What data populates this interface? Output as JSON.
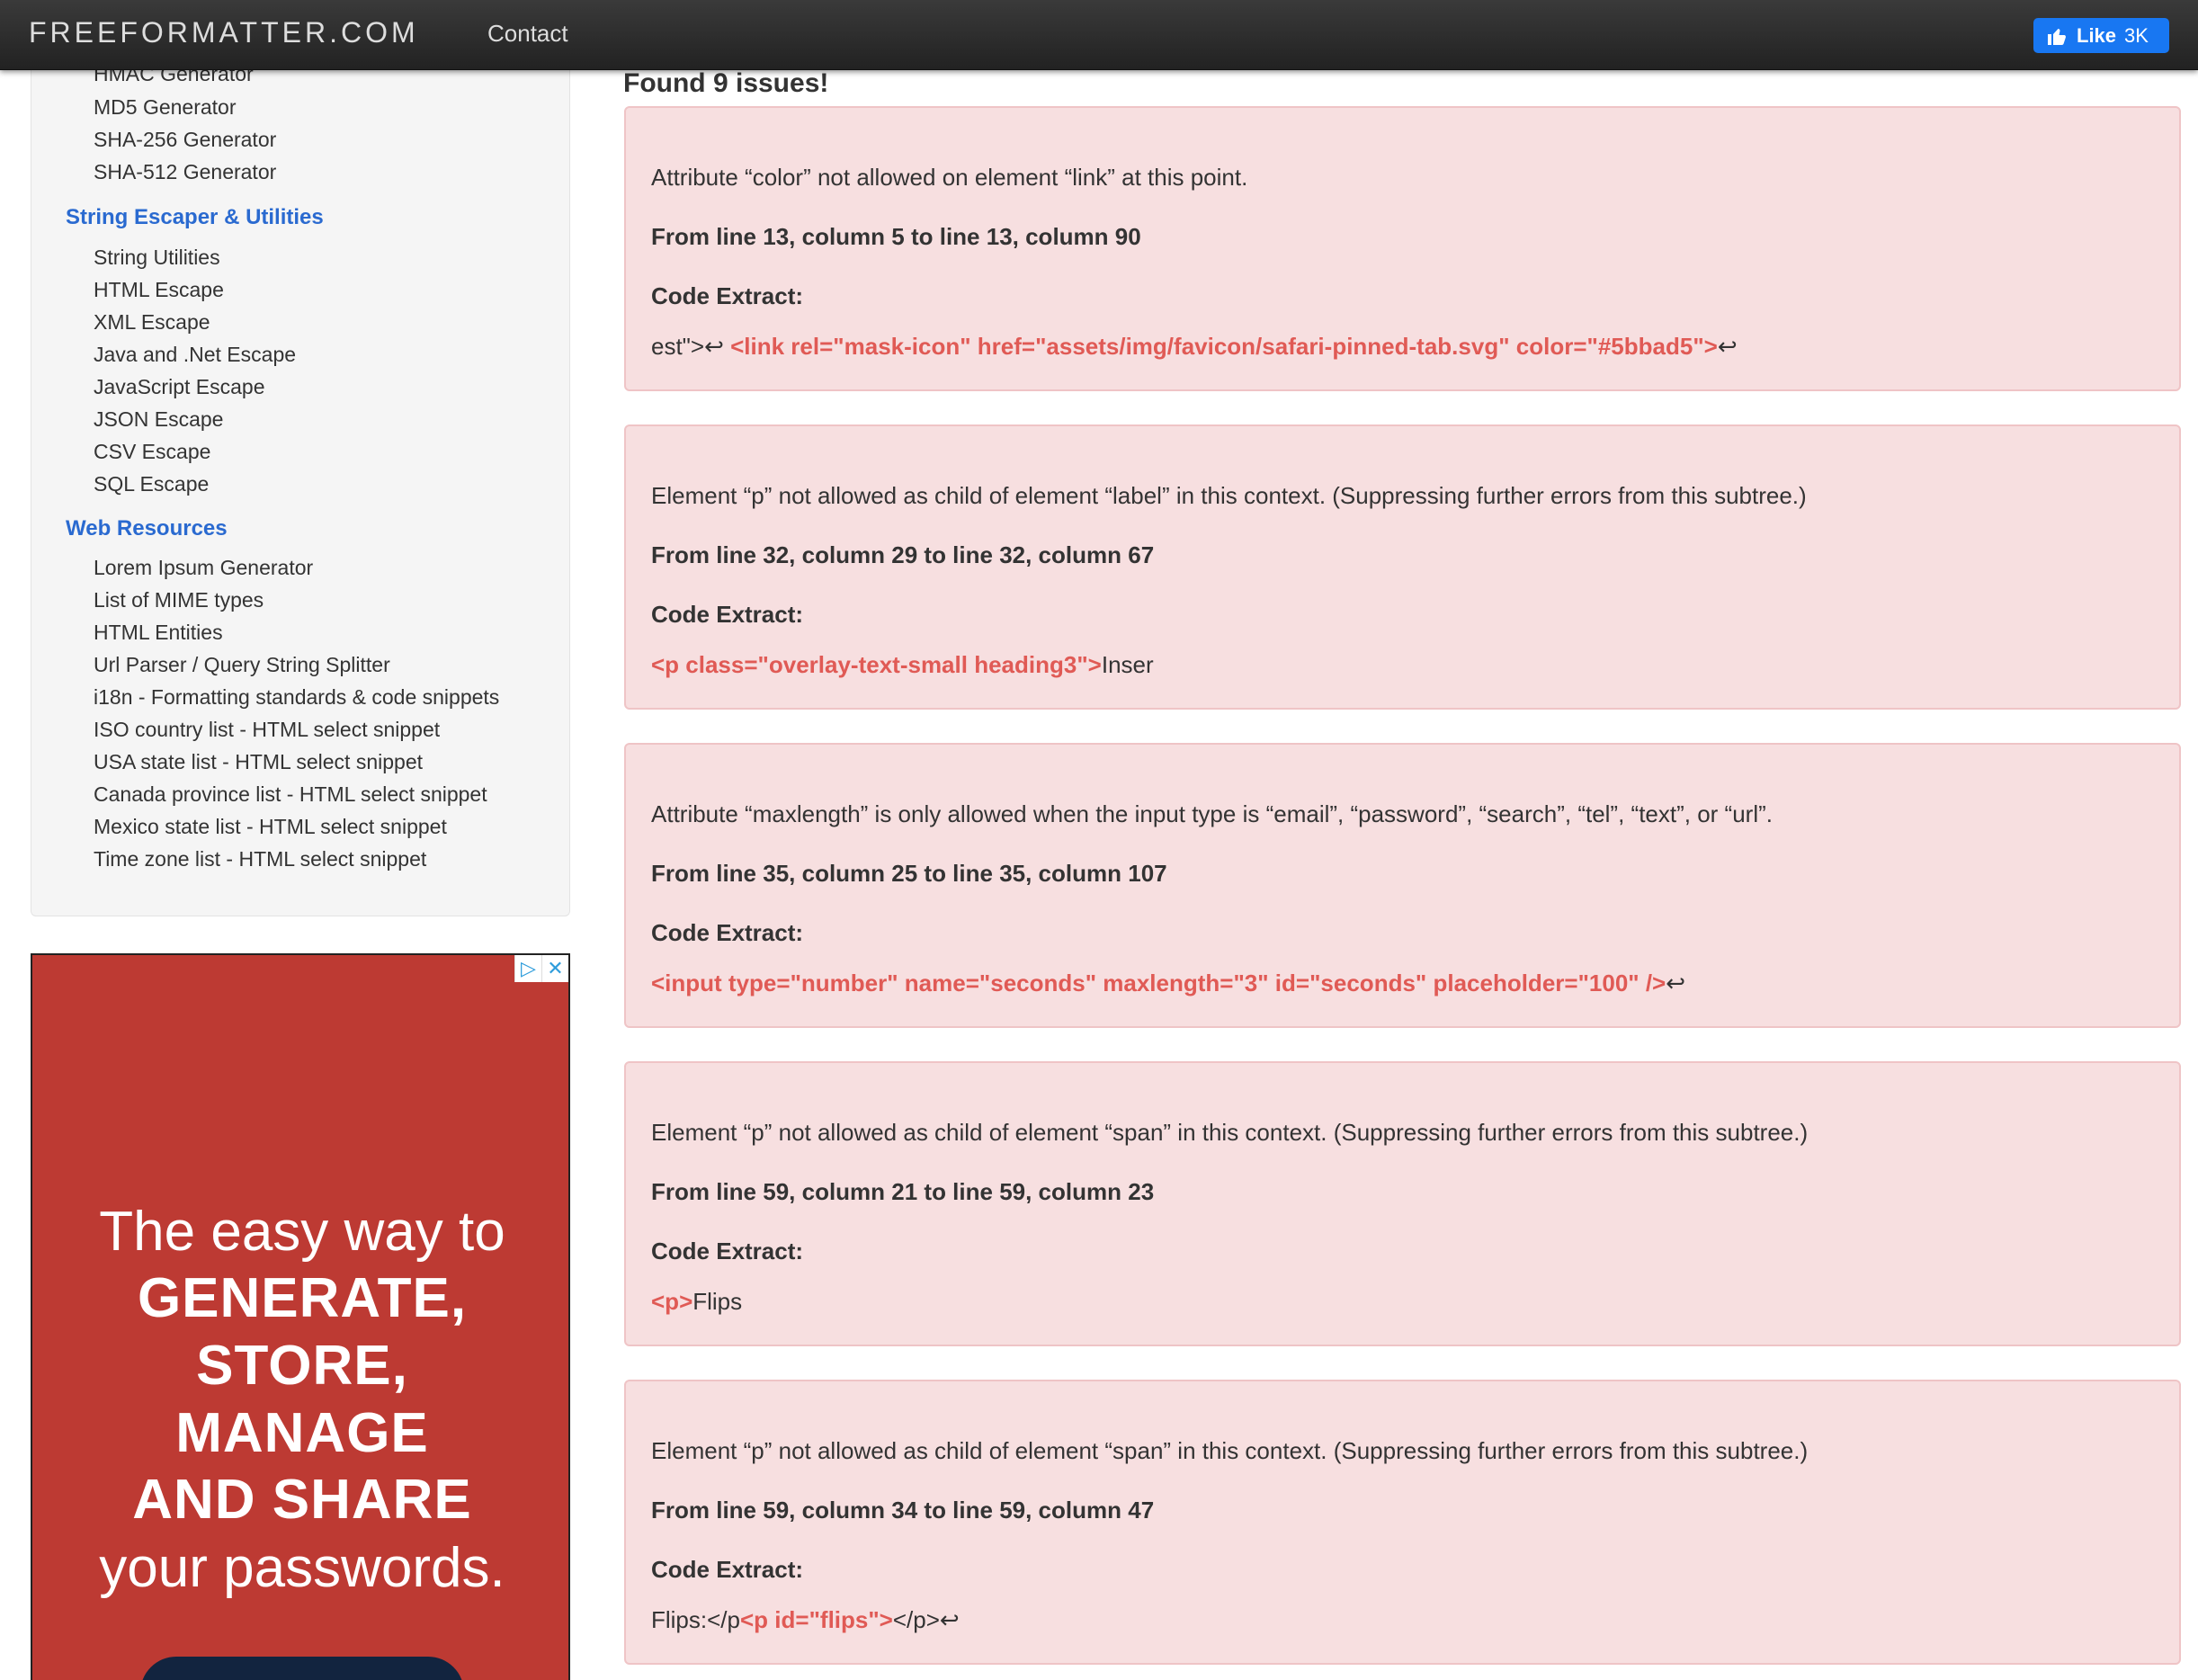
{
  "nav": {
    "brand": "FREEFORMATTER.COM",
    "contact": "Contact",
    "like_label": "Like",
    "like_count": "3K",
    "like_color": "#1877f2"
  },
  "sidebar": {
    "group_hash": [
      "HMAC Generator",
      "MD5 Generator",
      "SHA-256 Generator",
      "SHA-512 Generator"
    ],
    "heading_string": "String Escaper & Utilities",
    "group_string": [
      "String Utilities",
      "HTML Escape",
      "XML Escape",
      "Java and .Net Escape",
      "JavaScript Escape",
      "JSON Escape",
      "CSV Escape",
      "SQL Escape"
    ],
    "heading_web": "Web Resources",
    "group_web": [
      "Lorem Ipsum Generator",
      "List of MIME types",
      "HTML Entities",
      "Url Parser / Query String Splitter",
      "i18n - Formatting standards & code snippets",
      "ISO country list - HTML select snippet",
      "USA state list - HTML select snippet",
      "Canada province list - HTML select snippet",
      "Mexico state list - HTML select snippet",
      "Time zone list - HTML select snippet"
    ],
    "heading_color": "#2a6ad0"
  },
  "ad": {
    "line1": "The easy way to",
    "line2": "GENERATE,",
    "line3": "STORE,",
    "line4": "MANAGE",
    "line5": "AND SHARE",
    "line6": "your passwords.",
    "bg_color": "#bd3a33"
  },
  "main": {
    "found": "Found 9 issues!",
    "code_label": "Code Extract:",
    "issue_bg": "#f7dfe0",
    "highlight_color": "#e05a55",
    "issues": [
      {
        "message": "Attribute “color” not allowed on element “link” at this point.",
        "location": "From line 13, column 5 to line 13, column 90",
        "pre": "est\">↩ ",
        "highlight": "<link rel=\"mask-icon\" href=\"assets/img/favicon/safari-pinned-tab.svg\" color=\"#5bbad5\">",
        "post": "↩"
      },
      {
        "message": "Element “p” not allowed as child of element “label” in this context. (Suppressing further errors from this subtree.)",
        "location": "From line 32, column 29 to line 32, column 67",
        "pre": "",
        "highlight": "<p class=\"overlay-text-small heading3\">",
        "post": "Inser"
      },
      {
        "message": "Attribute “maxlength” is only allowed when the input type is “email”, “password”, “search”, “tel”, “text”, or “url”.",
        "location": "From line 35, column 25 to line 35, column 107",
        "pre": "",
        "highlight": "<input type=\"number\" name=\"seconds\" maxlength=\"3\" id=\"seconds\" placeholder=\"100\" />",
        "post": "↩"
      },
      {
        "message": "Element “p” not allowed as child of element “span” in this context. (Suppressing further errors from this subtree.)",
        "location": "From line 59, column 21 to line 59, column 23",
        "pre": "",
        "highlight": "<p>",
        "post": "Flips"
      },
      {
        "message": "Element “p” not allowed as child of element “span” in this context. (Suppressing further errors from this subtree.)",
        "location": "From line 59, column 34 to line 59, column 47",
        "pre": "Flips:</p",
        "highlight": "<p id=\"flips\">",
        "post": "</p>↩"
      }
    ]
  }
}
